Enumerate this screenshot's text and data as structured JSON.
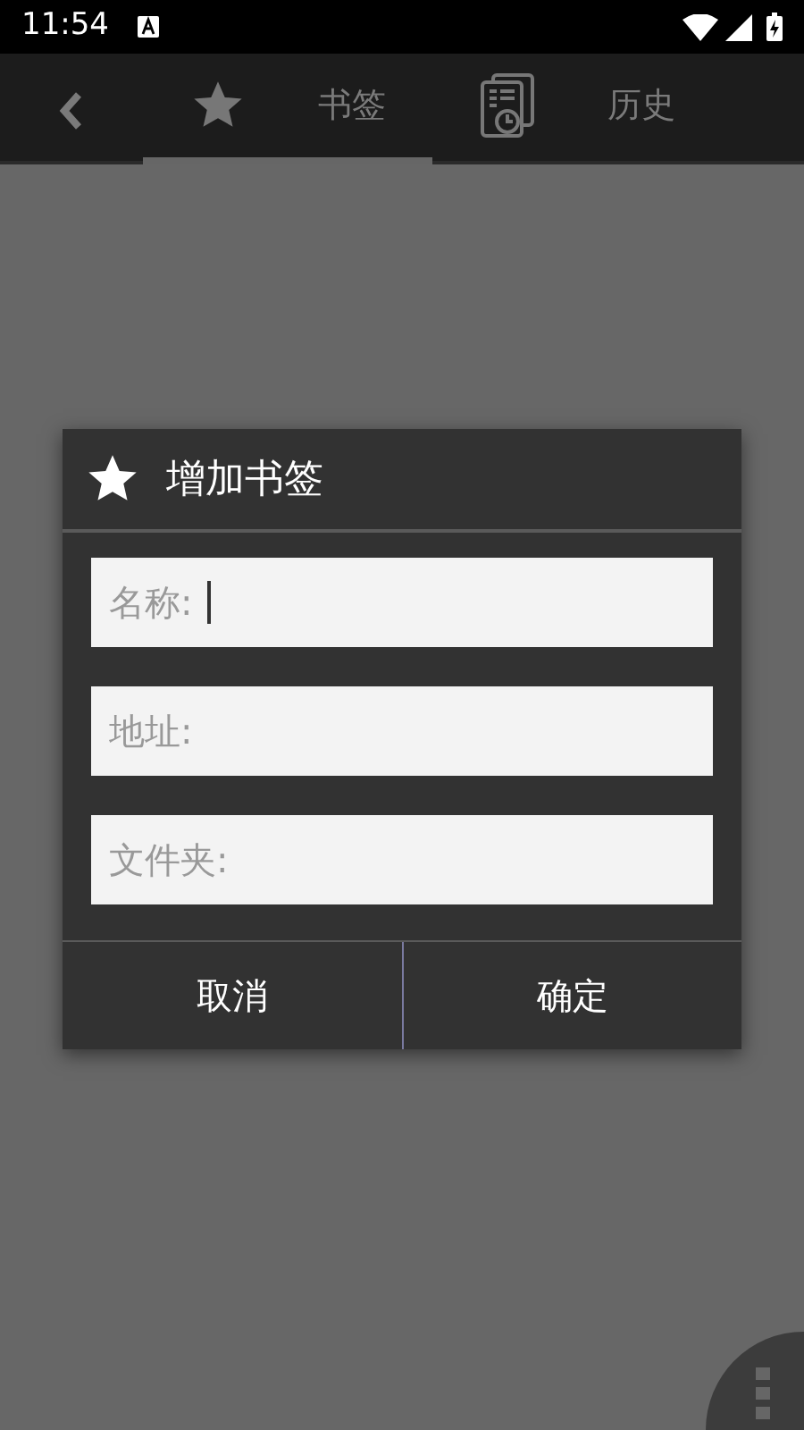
{
  "status_bar": {
    "time": "11:54"
  },
  "tabs": [
    {
      "label": "书签",
      "selected": true
    },
    {
      "label": "历史",
      "selected": false
    }
  ],
  "dialog": {
    "title": "增加书签",
    "fields": [
      {
        "placeholder": "名称:",
        "focused": true
      },
      {
        "placeholder": "地址:",
        "focused": false
      },
      {
        "placeholder": "文件夹:",
        "focused": false
      }
    ],
    "buttons": [
      "取消",
      "确定"
    ]
  }
}
